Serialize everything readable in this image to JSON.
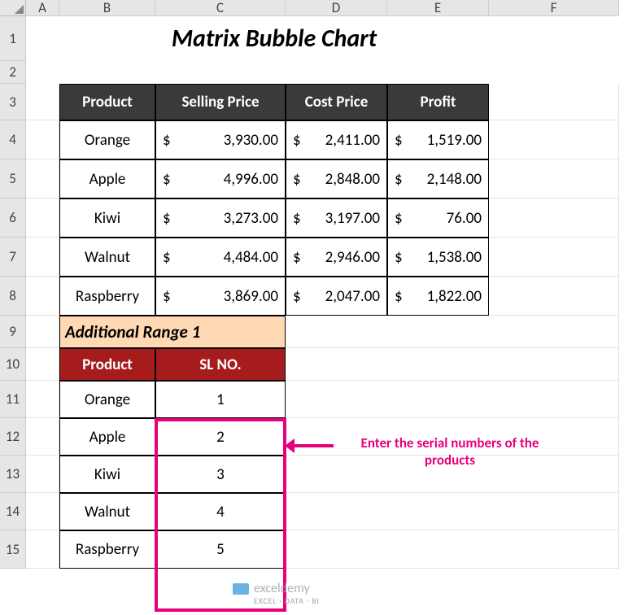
{
  "columns": [
    "A",
    "B",
    "C",
    "D",
    "E",
    "F"
  ],
  "rows": [
    "1",
    "2",
    "3",
    "4",
    "5",
    "6",
    "7",
    "8",
    "9",
    "10",
    "11",
    "12",
    "13",
    "14",
    "15"
  ],
  "title": "Matrix Bubble Chart",
  "table1": {
    "headers": [
      "Product",
      "Selling Price",
      "Cost Price",
      "Profit"
    ],
    "rows": [
      {
        "product": "Orange",
        "selling": "3,930.00",
        "cost": "2,411.00",
        "profit": "1,519.00"
      },
      {
        "product": "Apple",
        "selling": "4,996.00",
        "cost": "2,848.00",
        "profit": "2,148.00"
      },
      {
        "product": "Kiwi",
        "selling": "3,273.00",
        "cost": "3,197.00",
        "profit": "76.00"
      },
      {
        "product": "Walnut",
        "selling": "4,484.00",
        "cost": "2,946.00",
        "profit": "1,538.00"
      },
      {
        "product": "Raspberry",
        "selling": "3,869.00",
        "cost": "2,047.00",
        "profit": "1,822.00"
      }
    ],
    "currency": "$"
  },
  "subtitle": "Additional Range 1",
  "table2": {
    "headers": [
      "Product",
      "SL NO."
    ],
    "rows": [
      {
        "product": "Orange",
        "sl": "1"
      },
      {
        "product": "Apple",
        "sl": "2"
      },
      {
        "product": "Kiwi",
        "sl": "3"
      },
      {
        "product": "Walnut",
        "sl": "4"
      },
      {
        "product": "Raspberry",
        "sl": "5"
      }
    ]
  },
  "annotation": "Enter the serial numbers of the products",
  "watermark": {
    "brand": "exceldemy",
    "tag": "EXCEL · DATA · BI"
  },
  "chart_data": {
    "type": "table",
    "title": "Matrix Bubble Chart",
    "columns": [
      "Product",
      "Selling Price",
      "Cost Price",
      "Profit"
    ],
    "rows": [
      [
        "Orange",
        3930.0,
        2411.0,
        1519.0
      ],
      [
        "Apple",
        4996.0,
        2848.0,
        2148.0
      ],
      [
        "Kiwi",
        3273.0,
        3197.0,
        76.0
      ],
      [
        "Walnut",
        4484.0,
        2946.0,
        1538.0
      ],
      [
        "Raspberry",
        3869.0,
        2047.0,
        1822.0
      ]
    ]
  }
}
